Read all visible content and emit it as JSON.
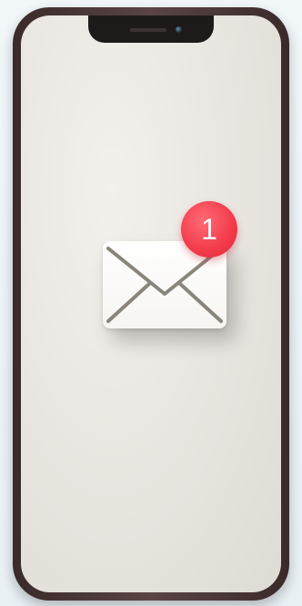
{
  "notification": {
    "icon": "mail-icon",
    "badge_count": "1",
    "badge_color": "#f23a4a"
  },
  "device": {
    "frame_color": "#3a2a2a",
    "screen_color": "#e8e5df"
  }
}
